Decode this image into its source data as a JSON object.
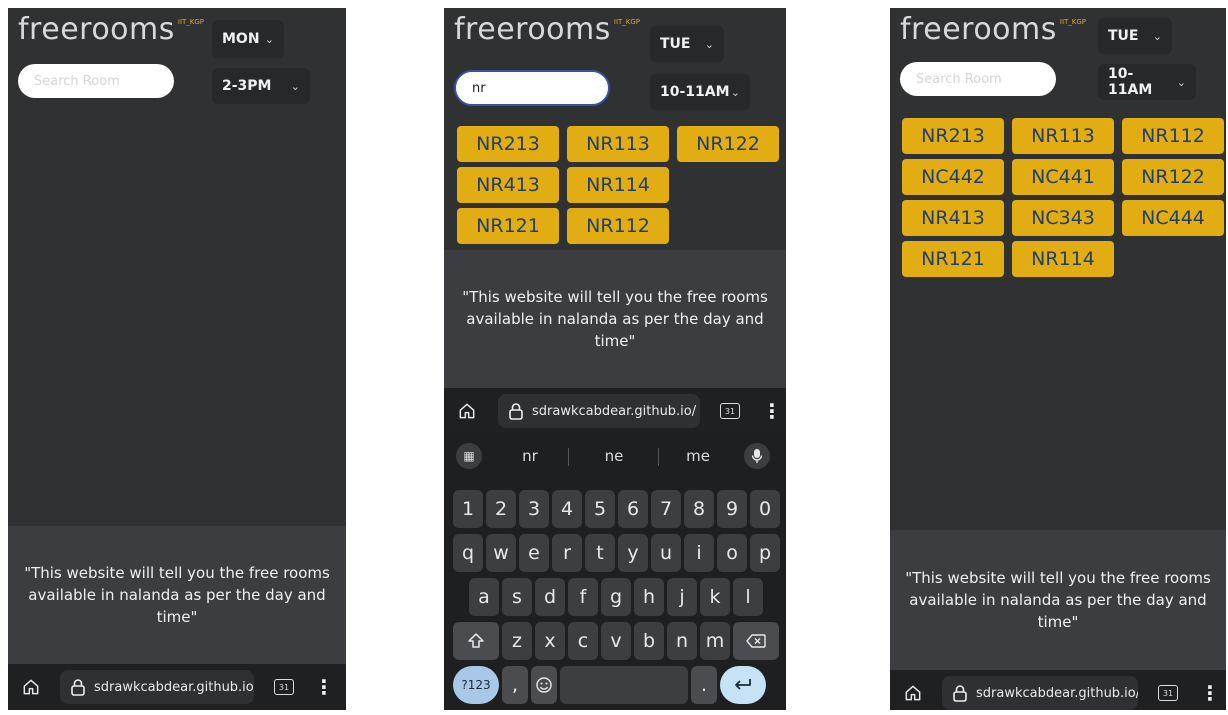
{
  "app": {
    "brand": "freerooms",
    "tag": "IIT_KGP"
  },
  "shared": {
    "search_placeholder": "Search Room",
    "description": "\"This website will tell you the free rooms available in nalanda as per the day and time\"",
    "url": "sdrawkcabdear.github.io/",
    "tab_count": "31"
  },
  "screens": [
    {
      "day": "MON",
      "time": "2-3PM",
      "search_value": "",
      "rooms": []
    },
    {
      "day": "TUE",
      "time": "10-11AM",
      "search_value": "nr",
      "rooms": [
        "NR213",
        "NR113",
        "NR122",
        "NR413",
        "NR114",
        "NR121",
        "NR112"
      ]
    },
    {
      "day": "TUE",
      "time": "10-11AM",
      "search_value": "",
      "rooms": [
        "NR213",
        "NR113",
        "NR112",
        "NC442",
        "NC441",
        "NR122",
        "NR413",
        "NC343",
        "NC444",
        "NR121",
        "NR114"
      ]
    }
  ],
  "keyboard": {
    "suggestions": [
      "nr",
      "ne",
      "me"
    ],
    "row1": [
      "1",
      "2",
      "3",
      "4",
      "5",
      "6",
      "7",
      "8",
      "9",
      "0"
    ],
    "row2": [
      "q",
      "w",
      "e",
      "r",
      "t",
      "y",
      "u",
      "i",
      "o",
      "p"
    ],
    "row3": [
      "a",
      "s",
      "d",
      "f",
      "g",
      "h",
      "j",
      "k",
      "l"
    ],
    "row4": [
      "z",
      "x",
      "c",
      "v",
      "b",
      "n",
      "m"
    ],
    "symbols_key": "?123",
    "comma": ",",
    "period": "."
  },
  "colors": {
    "accent": "#e2ad12",
    "room_text": "#213e6d",
    "page_bg": "#2f3133",
    "footer_bg": "#3b3d40"
  },
  "icons": [
    "home-icon",
    "lock-icon",
    "tabs-icon",
    "more-vert-icon",
    "chevron-down-icon",
    "apps-icon",
    "mic-icon",
    "shift-icon",
    "backspace-icon",
    "emoji-icon",
    "enter-icon"
  ]
}
